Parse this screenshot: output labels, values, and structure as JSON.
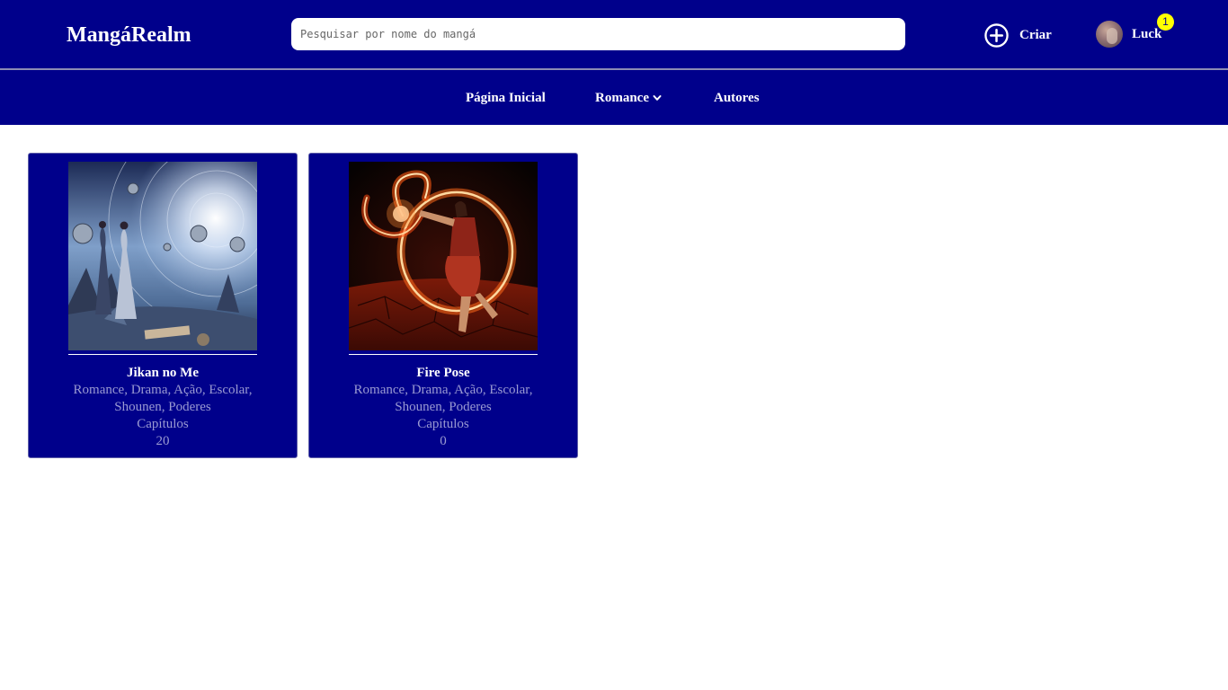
{
  "header": {
    "logo": "MangáRealm",
    "search_placeholder": "Pesquisar por nome do mangá",
    "create_label": "Criar",
    "create_icon": "plus-circle-icon",
    "user_name": "Luck",
    "notification_count": "1"
  },
  "nav": {
    "items": [
      {
        "label": "Página Inicial"
      },
      {
        "label": "Romance",
        "icon": "chevron-down-icon"
      },
      {
        "label": "Autores"
      }
    ]
  },
  "mangas": [
    {
      "title": "Jikan no Me",
      "genres": "Romance, Drama, Ação, Escolar, Shounen, Poderes",
      "chapters_label": "Capítulos",
      "chapters_count": "20"
    },
    {
      "title": "Fire Pose",
      "genres": "Romance, Drama, Ação, Escolar, Shounen, Poderes",
      "chapters_label": "Capítulos",
      "chapters_count": "0"
    }
  ],
  "colors": {
    "primary": "#00008b",
    "badge": "#ffff00",
    "muted_text": "#9a9ad2"
  }
}
